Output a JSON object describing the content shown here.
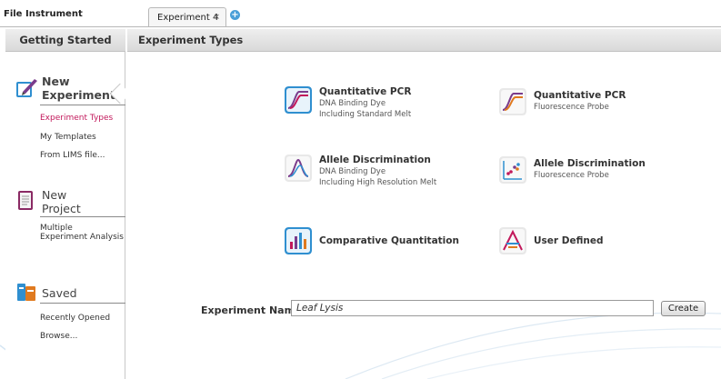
{
  "menu": {
    "file": "File",
    "instrument": "Instrument"
  },
  "tabs": [
    {
      "label": "Experiment 4",
      "close": "×"
    }
  ],
  "tab_add": "+",
  "left_panel": {
    "header": "Getting Started",
    "new_experiment": {
      "title_line1": "New",
      "title_line2": "Experiment",
      "links": [
        "Experiment Types",
        "My Templates",
        "From LIMS file..."
      ]
    },
    "new_project": {
      "title_line1": "New",
      "title_line2": "Project",
      "links": [
        "Multiple",
        "Experiment Analysis"
      ]
    },
    "saved": {
      "title": "Saved",
      "links": [
        "Recently Opened",
        "Browse..."
      ]
    }
  },
  "main": {
    "header": "Experiment Types",
    "types": [
      {
        "title": "Quantitative PCR",
        "sub1": "DNA Binding Dye",
        "sub2": "Including Standard Melt",
        "icon": "qpcr-curve-icon"
      },
      {
        "title": "Quantitative PCR",
        "sub1": "Fluorescence Probe",
        "sub2": "",
        "icon": "qpcr-curve-icon"
      },
      {
        "title": "Allele Discrimination",
        "sub1": "DNA Binding Dye",
        "sub2": "Including High Resolution Melt",
        "icon": "melt-peak-icon"
      },
      {
        "title": "Allele Discrimination",
        "sub1": "Fluorescence Probe",
        "sub2": "",
        "icon": "cluster-plot-icon"
      },
      {
        "title": "Comparative Quantitation",
        "sub1": "",
        "sub2": "",
        "icon": "bar-chart-icon"
      },
      {
        "title": "User Defined",
        "sub1": "",
        "sub2": "",
        "icon": "custom-peak-icon"
      }
    ],
    "experiment_name_label": "Experiment Name",
    "experiment_name_value": "Leaf Lysis",
    "create_label": "Create"
  },
  "colors": {
    "active_link": "#c2185b",
    "accent_blue": "#4a9fd8"
  }
}
